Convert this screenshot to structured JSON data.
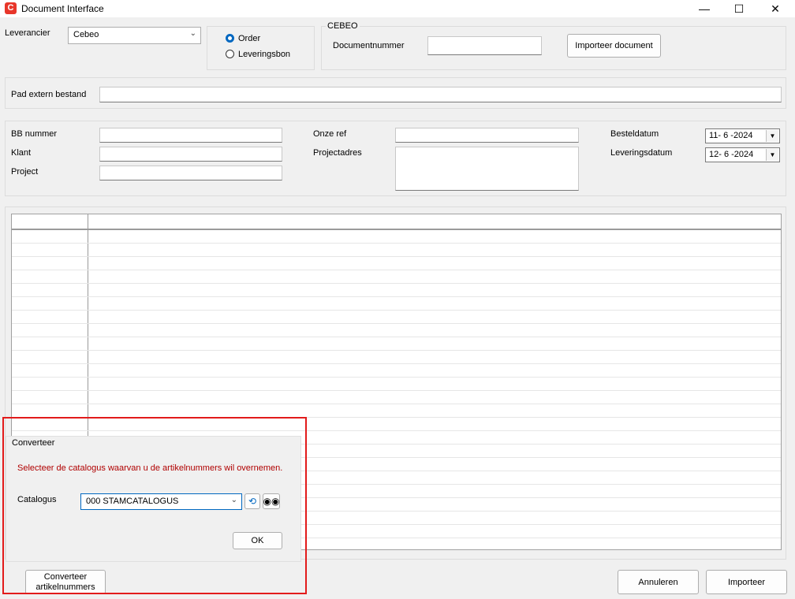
{
  "window": {
    "title": "Document Interface",
    "app_icon": "C"
  },
  "supplier": {
    "label": "Leverancier",
    "value": "Cebeo"
  },
  "doc_type": {
    "options": [
      "Order",
      "Leveringsbon"
    ],
    "selected": "Order"
  },
  "cebeo": {
    "legend": "CEBEO",
    "docnum_label": "Documentnummer",
    "docnum_value": "",
    "import_doc_button": "Importeer document"
  },
  "path": {
    "label": "Pad extern bestand",
    "value": ""
  },
  "info": {
    "bb_label": "BB nummer",
    "klant_label": "Klant",
    "project_label": "Project",
    "onze_ref_label": "Onze ref",
    "projectadres_label": "Projectadres",
    "besteld_label": "Besteldatum",
    "besteld_value": "11- 6 -2024",
    "levering_label": "Leveringsdatum",
    "levering_value": "12- 6 -2024"
  },
  "grid": {
    "row_count": 24
  },
  "converter": {
    "legend": "Converteer",
    "message": "Selecteer de catalogus waarvan u de artikelnummers wil overnemen.",
    "catalog_label": "Catalogus",
    "catalog_value": "000  STAMCATALOGUS",
    "ok_button": "OK"
  },
  "footer": {
    "convert_line1": "Converteer",
    "convert_line2": "artikelnummers",
    "cancel_button": "Annuleren",
    "import_button": "Importeer"
  },
  "colors": {
    "accent": "#0067c0",
    "warning_text": "#b00000",
    "highlight": "#e21b1b",
    "app_icon": "#e8362a"
  }
}
